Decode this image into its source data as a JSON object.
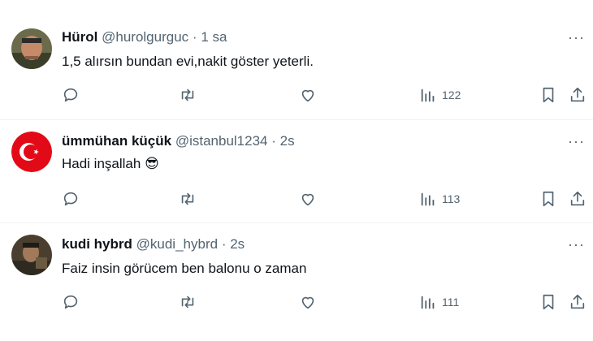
{
  "tweets": [
    {
      "name": "Hürol",
      "handle": "@hurolgurguc",
      "separator": "·",
      "time": "1 sa",
      "text": "1,5 alırsın bundan evi,nakit göster yeterli.",
      "views": "122",
      "avatar_icon": "person-photo"
    },
    {
      "name": "ümmühan küçük",
      "handle": "@istanbul1234",
      "separator": "·",
      "time": "2s",
      "text": "Hadi inşallah",
      "emoji": "😎",
      "views": "113",
      "avatar_icon": "turkish-flag"
    },
    {
      "name": "kudi hybrd",
      "handle": "@kudi_hybrd",
      "separator": "·",
      "time": "2s",
      "text": "Faiz insin görücem ben balonu o zaman",
      "views": "111",
      "avatar_icon": "person-photo"
    }
  ],
  "more_label": "···",
  "colors": {
    "text": "#0f1419",
    "muted": "#536471",
    "flag_red": "#e30a17",
    "divider": "#eff3f4"
  }
}
